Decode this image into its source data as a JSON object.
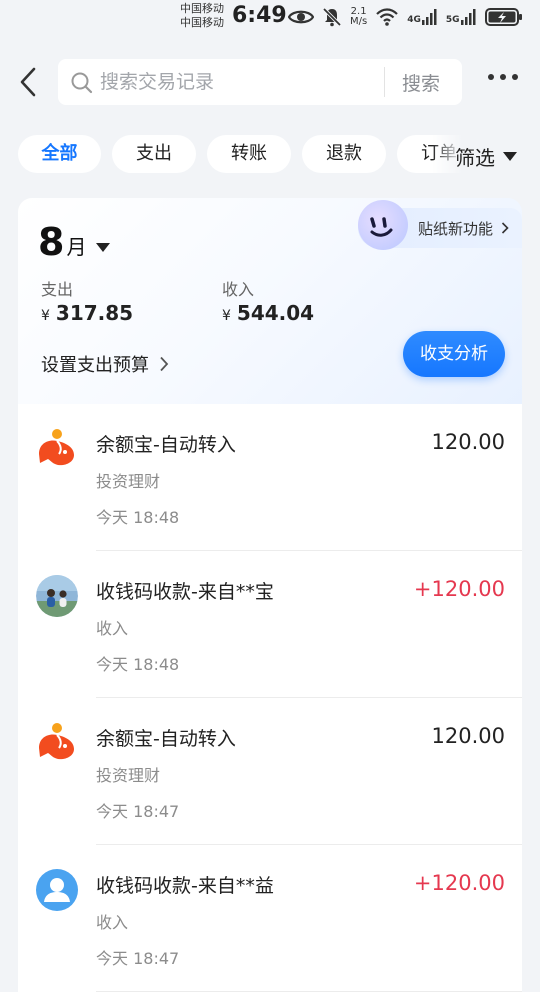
{
  "status_bar": {
    "carrier1": "中国移动",
    "carrier2": "中国移动",
    "time": "6:49",
    "net_speed_value": "2.1",
    "net_speed_unit": "M/s",
    "network1": "4G",
    "network2": "5G"
  },
  "header": {
    "search_placeholder": "搜索交易记录",
    "search_button": "搜索"
  },
  "filters": {
    "chips": [
      "全部",
      "支出",
      "转账",
      "退款",
      "订单"
    ],
    "active": "全部",
    "filter_label": "筛选"
  },
  "summary": {
    "month_number": "8",
    "month_unit": "月",
    "expense_label": "支出",
    "expense_value": "317.85",
    "income_label": "收入",
    "income_value": "544.04",
    "currency": "¥",
    "budget_link": "设置支出预算",
    "analysis_button": "收支分析",
    "sticker_label": "贴纸新功能"
  },
  "transactions": [
    {
      "title": "余额宝-自动转入",
      "category": "投资理财",
      "time": "今天 18:48",
      "amount": "120.00",
      "icon": "yuebao-icon"
    },
    {
      "title": "收钱码收款-来自**宝",
      "category": "收入",
      "time": "今天 18:48",
      "amount": "+120.00",
      "icon": "user-photo-avatar"
    },
    {
      "title": "余额宝-自动转入",
      "category": "投资理财",
      "time": "今天 18:47",
      "amount": "120.00",
      "icon": "yuebao-icon"
    },
    {
      "title": "收钱码收款-来自**益",
      "category": "收入",
      "time": "今天 18:47",
      "amount": "+120.00",
      "icon": "default-user-avatar"
    }
  ],
  "colors": {
    "accent": "#1677ff",
    "income": "#e5384f",
    "yuebao": "#f24c1f"
  }
}
